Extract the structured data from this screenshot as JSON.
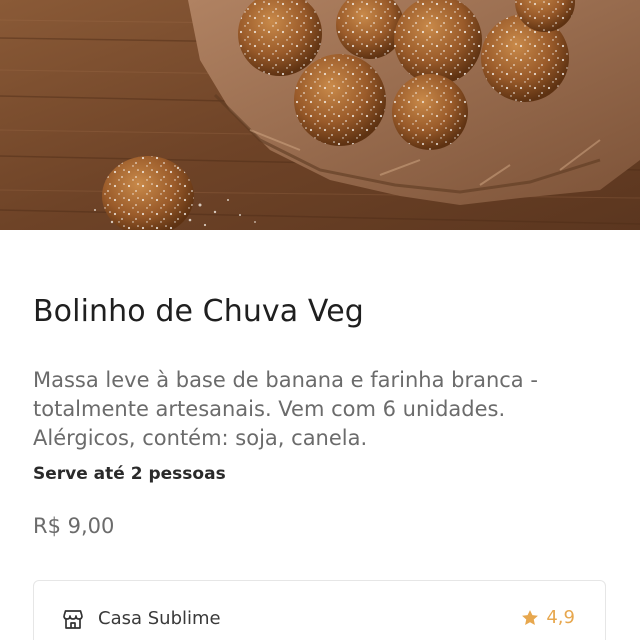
{
  "product": {
    "image_icon": "food-photo",
    "title": "Bolinho de Chuva Veg",
    "description": "Massa leve à base de banana e farinha branca - totalmente artesanais. Vem com 6 unidades. Alérgicos, contém: soja, canela.",
    "serves": "Serve até 2 pessoas",
    "price": "R$ 9,00"
  },
  "store": {
    "icon": "store-icon",
    "name": "Casa Sublime",
    "rating_icon": "star-icon",
    "rating": "4,9"
  },
  "colors": {
    "title": "#1f1f1f",
    "muted_text": "#6b6b6b",
    "rating": "#e7a74e",
    "card_border": "#e6e6e6"
  }
}
